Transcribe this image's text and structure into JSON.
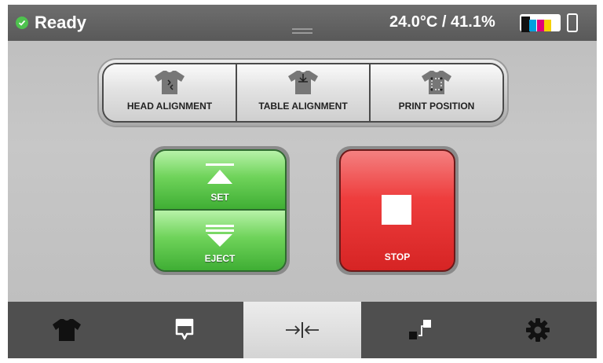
{
  "status": {
    "state_label": "Ready",
    "temp_humidity": "24.0°C / 41.1%",
    "ink_colors": [
      "#ffffff",
      "#00a0e0",
      "#e0007a",
      "#f5d000",
      "#ffffff"
    ],
    "ink_levels": [
      1.0,
      0.85,
      0.85,
      0.85,
      0.85
    ],
    "accent_green": "#4ec24e"
  },
  "alignment": {
    "buttons": [
      {
        "label": "HEAD ALIGNMENT",
        "icon": "shirt-arrows-icon"
      },
      {
        "label": "TABLE ALIGNMENT",
        "icon": "shirt-down-arrow-icon"
      },
      {
        "label": "PRINT POSITION",
        "icon": "shirt-target-icon"
      }
    ]
  },
  "platen": {
    "set_label": "SET",
    "eject_label": "EJECT",
    "set_icon": "arrow-up-bar-icon",
    "eject_icon": "arrow-down-bar-icon",
    "color": "#6fd35a"
  },
  "stop": {
    "label": "STOP",
    "icon": "stop-square-icon",
    "color": "#ee3d3d"
  },
  "nav": {
    "items": [
      {
        "icon": "tshirt-icon",
        "active": false
      },
      {
        "icon": "ink-tag-icon",
        "active": false
      },
      {
        "icon": "align-arrows-icon",
        "active": true
      },
      {
        "icon": "transfer-icon",
        "active": false
      },
      {
        "icon": "gear-icon",
        "active": false
      }
    ]
  }
}
